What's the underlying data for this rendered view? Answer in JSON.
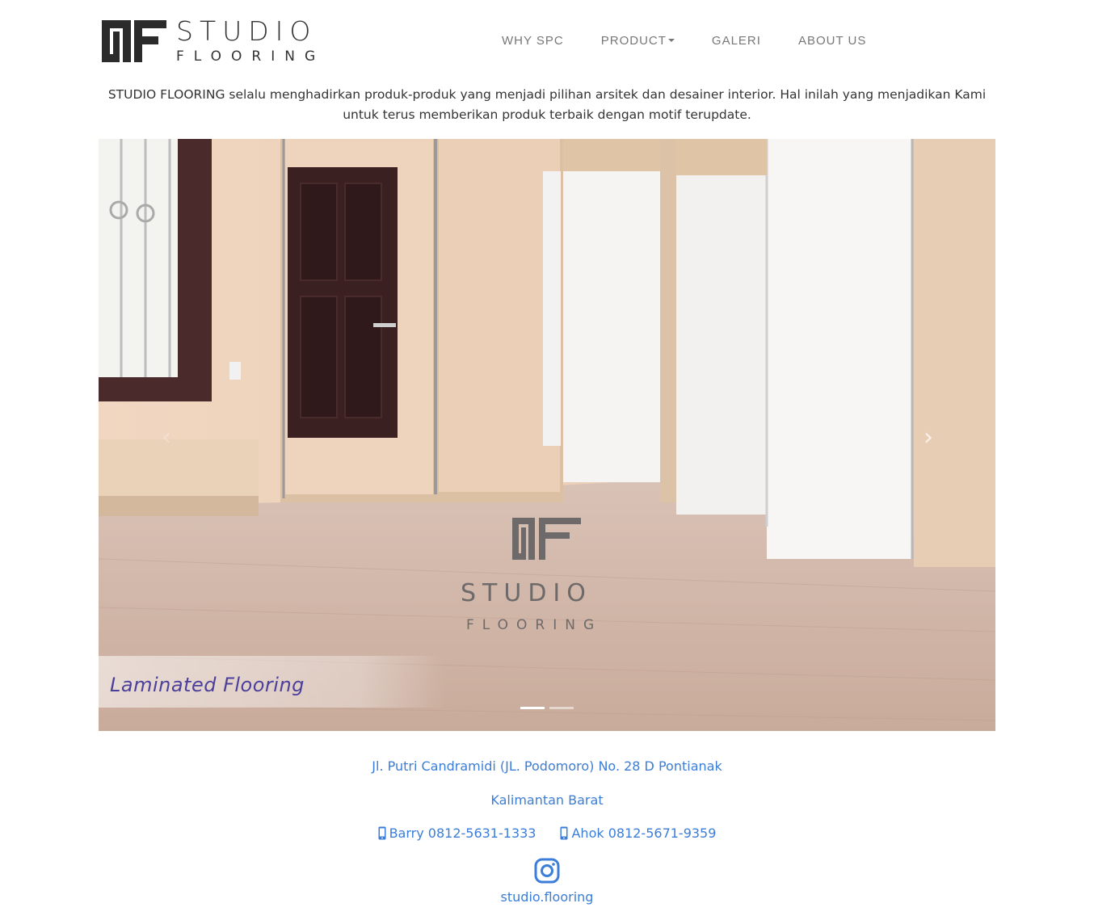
{
  "brand": {
    "line1": "STUDIO",
    "line2": "FLOORING"
  },
  "nav": {
    "items": [
      {
        "label": "WHY SPC"
      },
      {
        "label": "PRODUCT"
      },
      {
        "label": "GALERI"
      },
      {
        "label": "ABOUT US"
      }
    ]
  },
  "intro": {
    "text": "STUDIO FLOORING selalu menghadirkan produk-produk yang menjadi pilihan arsitek dan desainer interior. Hal inilah yang menjadikan Kami untuk terus memberikan produk terbaik dengan motif terupdate."
  },
  "carousel": {
    "caption": "Laminated Flooring",
    "watermark_line1": "STUDIO",
    "watermark_line2": "FLOORING",
    "prev_icon": "chevron-left-icon",
    "next_icon": "chevron-right-icon",
    "slide_count": 2,
    "active_index": 0
  },
  "contact": {
    "address_line1": "Jl. Putri Candramidi (JL. Podomoro) No. 28 D Pontianak",
    "address_line2": "Kalimantan Barat",
    "phones": [
      {
        "label": "Barry 0812-5631-1333",
        "icon": "mobile-phone-icon"
      },
      {
        "label": "Ahok 0812-5671-9359",
        "icon": "mobile-phone-icon"
      }
    ],
    "instagram_icon": "instagram-icon",
    "instagram_handle": "studio.flooring"
  },
  "colors": {
    "link": "#3b7dd8",
    "caption": "#4b3f9c",
    "nav": "#777777"
  }
}
